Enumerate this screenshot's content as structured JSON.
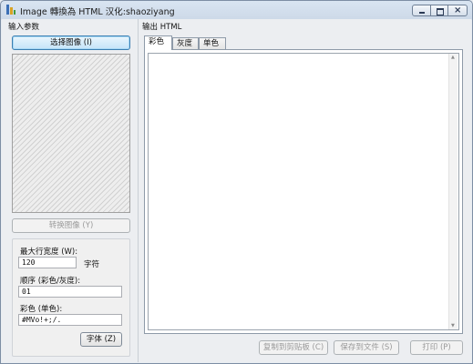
{
  "window": {
    "title": "Image 轉換為 HTML   汉化:shaoziyang"
  },
  "left": {
    "section_label": "输入参数",
    "select_image_button": "选择图像 (I)",
    "convert_image_button": "转换图像 (Y)",
    "max_width_label": "最大行宽度 (W):",
    "max_width_value": "120",
    "max_width_unit": "字符",
    "order_label": "顺序 (彩色/灰度):",
    "order_value": "01",
    "color_mono_label": "彩色 (单色):",
    "color_mono_value": "#MVo!+;/.",
    "font_button": "字体 (Z)"
  },
  "right": {
    "section_label": "输出 HTML",
    "tabs": [
      {
        "label": "彩色",
        "active": true
      },
      {
        "label": "灰度",
        "active": false
      },
      {
        "label": "单色",
        "active": false
      }
    ],
    "output_text": "",
    "copy_button": "复制到剪贴板 (C)",
    "save_button": "保存到文件 (S)",
    "print_button": "打印 (P)"
  },
  "icons": {
    "app": "image-to-html-app-icon",
    "minimize": "minimize-icon",
    "maximize": "maximize-icon",
    "close": "close-icon",
    "scroll_up": "scroll-up-arrow-icon",
    "scroll_down": "scroll-down-arrow-icon"
  },
  "colors": {
    "default_button_border": "#3c7fb1",
    "window_frame": "#7d8ea4"
  }
}
